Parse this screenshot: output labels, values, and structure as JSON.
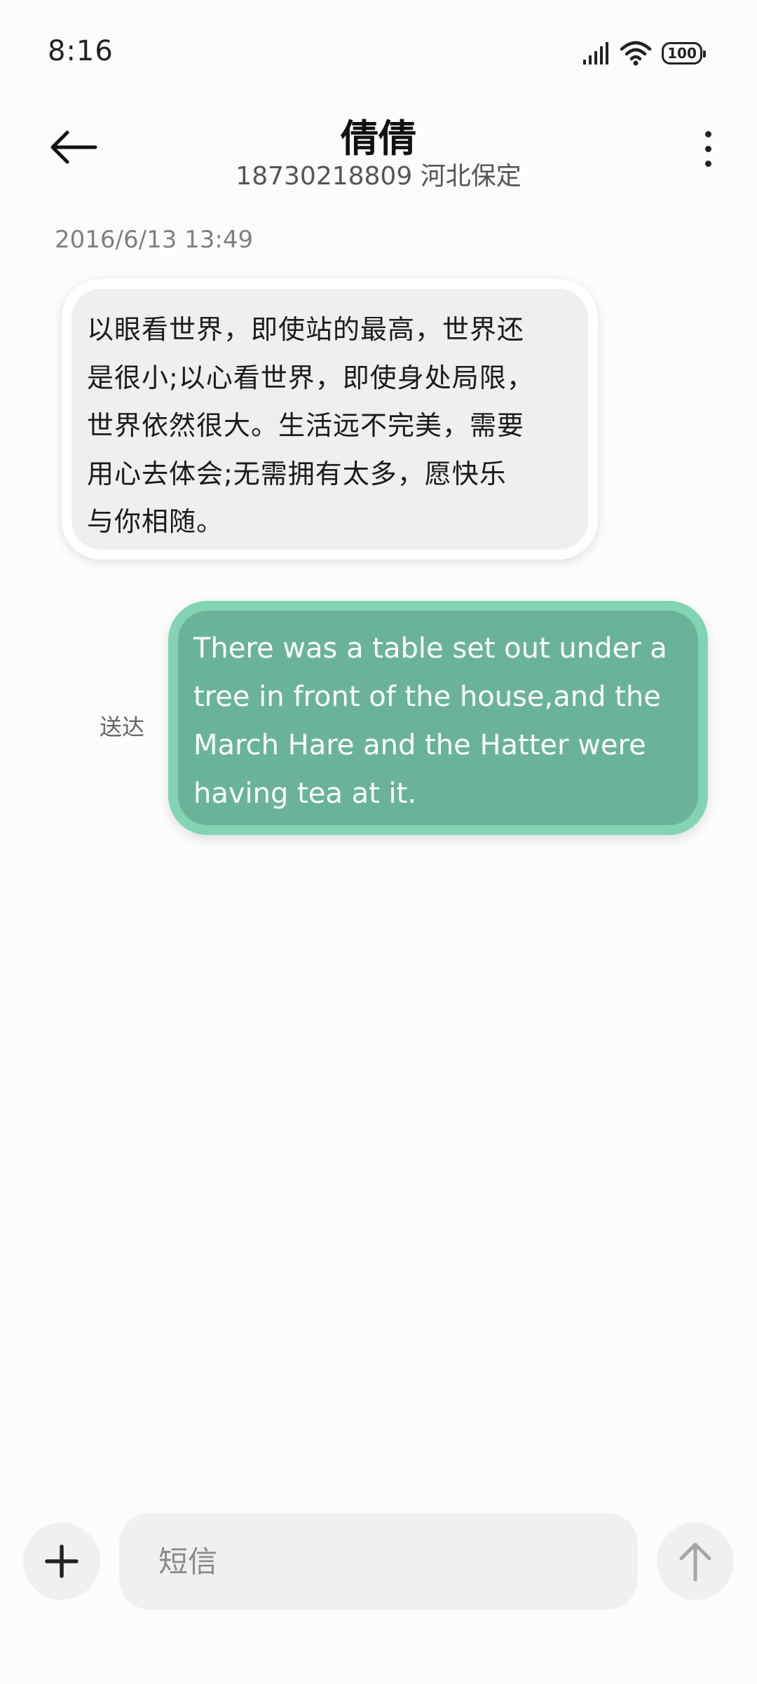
{
  "status_bar": {
    "time": "8:16",
    "battery": "100",
    "icons": [
      "signal-icon",
      "wifi-icon",
      "battery-icon"
    ]
  },
  "header": {
    "title": "倩倩",
    "subtitle": "18730218809 河北保定",
    "back_icon": "back-arrow-icon",
    "more_icon": "more-vertical-icon"
  },
  "messages": {
    "timestamp": "2016/6/13 13:49",
    "incoming": {
      "lines": [
        "以眼看世界，即使站的最高，世界还",
        "是很小;以心看世界，即使身处局限，",
        "世界依然很大。生活远不完美，需要",
        "用心去体会;无需拥有太多，愿快乐",
        "与你相随。"
      ]
    },
    "outgoing": {
      "status": "送达",
      "lines": [
        "There was a table set out under a",
        "tree in front of the house,and the",
        "March Hare and the Hatter were",
        "having tea at it."
      ]
    }
  },
  "composer": {
    "placeholder": "短信",
    "value": "",
    "add_icon": "plus-icon",
    "send_icon": "send-arrow-icon"
  },
  "colors": {
    "incoming_bubble": "#eeeff1",
    "outgoing_bubble": "#6ab39a",
    "outgoing_border": "#82d4b3",
    "background": "#fcfcfc"
  }
}
